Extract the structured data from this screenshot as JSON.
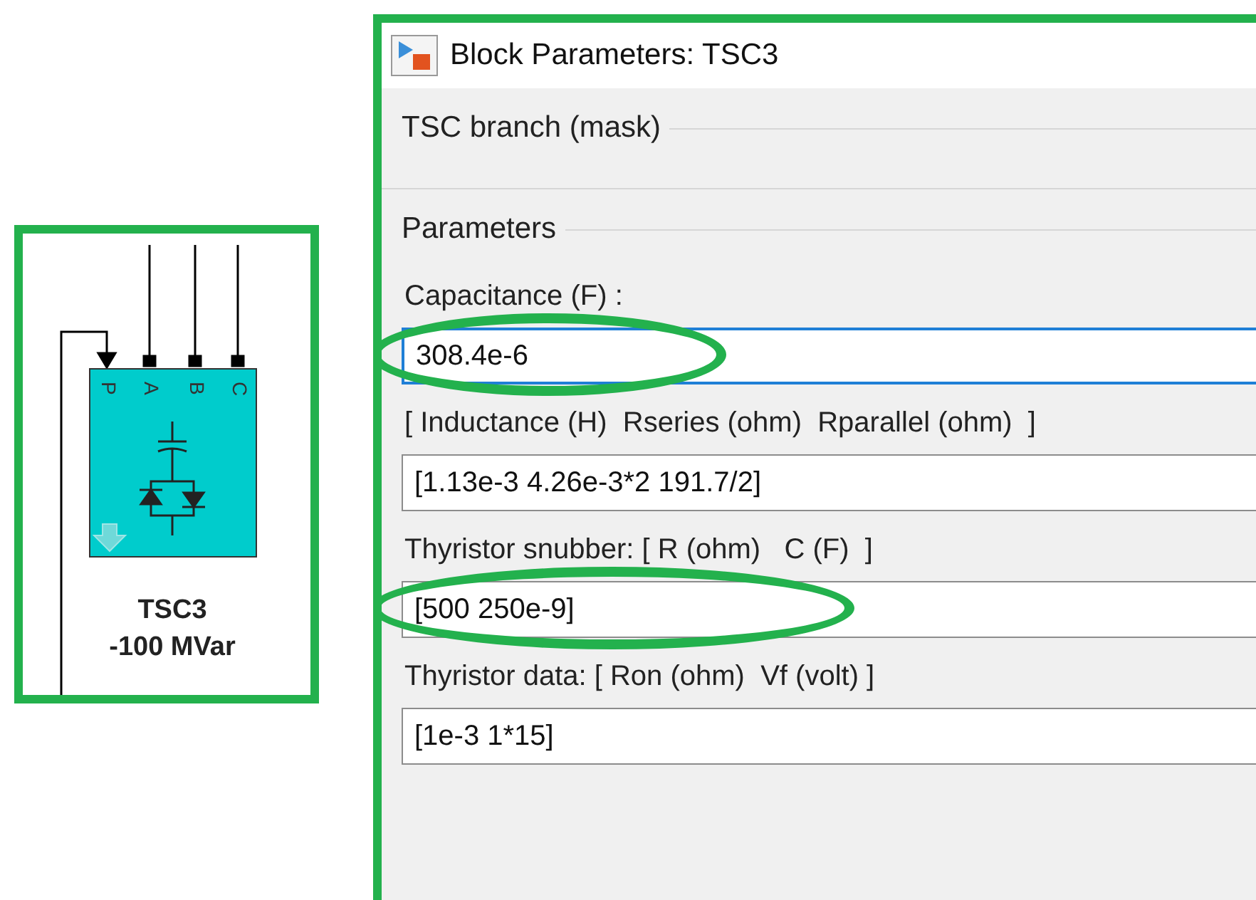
{
  "diagram": {
    "ports": [
      "P",
      "A",
      "B",
      "C"
    ],
    "block_name": "TSC3",
    "block_rating": "-100 MVar"
  },
  "dialog": {
    "title": "Block Parameters: TSC3",
    "mask_title": "TSC branch (mask)",
    "section": "Parameters",
    "fields": [
      {
        "label": "Capacitance (F) :",
        "value": "308.4e-6",
        "focused": true,
        "highlighted": true
      },
      {
        "label": "[ Inductance (H)  Rseries (ohm)  Rparallel (ohm)  ]",
        "value": "[1.13e-3 4.26e-3*2 191.7/2]",
        "focused": false,
        "highlighted": false
      },
      {
        "label": "Thyristor snubber: [ R (ohm)   C (F)  ]",
        "value": "[500 250e-9]",
        "focused": false,
        "highlighted": true
      },
      {
        "label": "Thyristor data: [ Ron (ohm)  Vf (volt) ]",
        "value": "[1e-3 1*15]",
        "focused": false,
        "highlighted": false
      }
    ]
  }
}
